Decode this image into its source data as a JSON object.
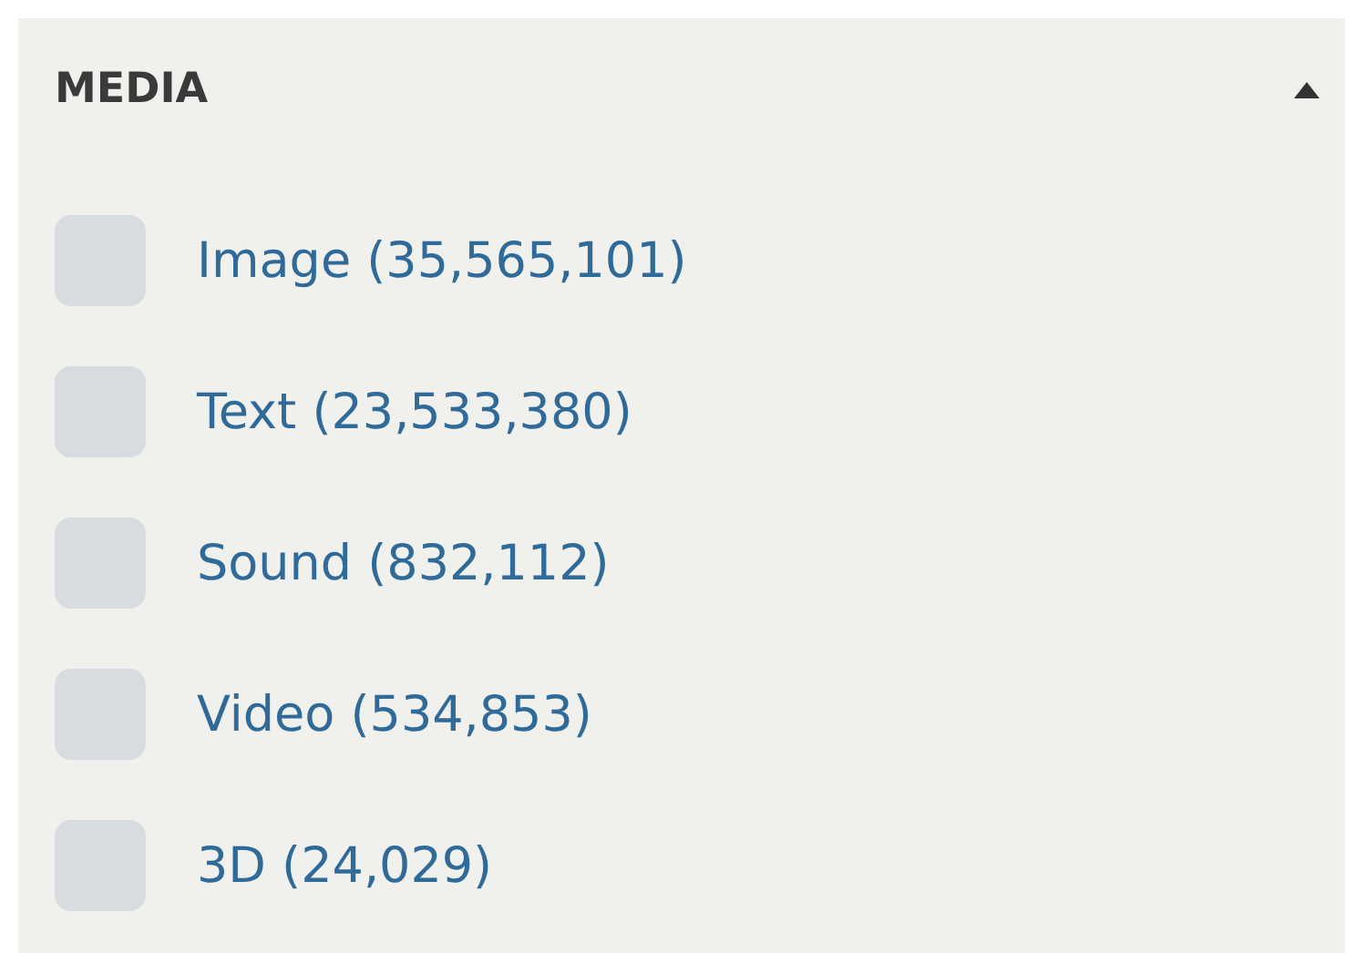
{
  "section": {
    "title": "MEDIA",
    "expanded": true,
    "items": [
      {
        "label": "Image (35,565,101)",
        "checked": false
      },
      {
        "label": "Text (23,533,380)",
        "checked": false
      },
      {
        "label": "Sound (832,112)",
        "checked": false
      },
      {
        "label": "Video (534,853)",
        "checked": false
      },
      {
        "label": "3D (24,029)",
        "checked": false
      }
    ]
  }
}
